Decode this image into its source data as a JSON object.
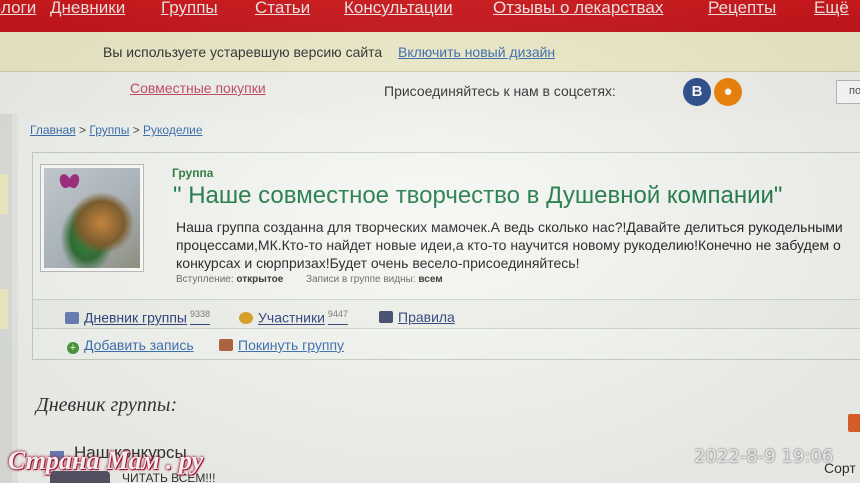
{
  "topnav": {
    "items": [
      "Блоги",
      "Дневники",
      "Группы",
      "Статьи",
      "Консультации",
      "Отзывы о лекарствах",
      "Рецепты",
      "Ещё"
    ]
  },
  "notice": {
    "text": "Вы используете устаревшую версию сайта",
    "link": "Включить новый дизайн"
  },
  "jointbar": {
    "purchases": "Совместные покупки",
    "join_text": "Присоединяйтесь к нам в соцсетях:",
    "vk": "В",
    "ok": "Ok",
    "search_stub": "по"
  },
  "breadcrumb": {
    "home": "Главная",
    "sep1": " > ",
    "groups": "Группы",
    "sep2": " > ",
    "craft": "Рукоделие"
  },
  "group": {
    "type": "Группа",
    "title": "\" Наше совместное творчество в Душевной компании\"",
    "description": "Наша группа созданна для творческих мамочек.А ведь сколько нас?!Давайте делиться рукодельными процессами,МК.Кто-то найдет новые идеи,а кто-то научится новому рукоделию!Конечно не забудем о конкурсах и сюрпризах!Будет очень весело-присоединяйтесь!",
    "join_label": "Вступление:",
    "join_value": "открытое",
    "visible_label": "Записи в группе видны:",
    "visible_value": "всем"
  },
  "tabs": {
    "diary": "Дневник группы",
    "diary_count": "9338",
    "members": "Участники",
    "members_count": "9447",
    "rules": "Правила"
  },
  "actions": {
    "add": "Добавить запись",
    "leave": "Покинуть группу"
  },
  "diary": {
    "heading": "Дневник группы:",
    "post_title": "Наш конкурсы",
    "read_all": "ЧИТАТЬ ВСЕМ!!!",
    "sort": "Сорт"
  },
  "watermark": {
    "site": "Страна Мам . ру",
    "datetime": "2022-8-9  19:06"
  },
  "colors": {
    "nav_red": "#c5161b",
    "group_green": "#1f7a47",
    "link_blue": "#3b6fb0",
    "vk_blue": "#2d4f8e",
    "ok_orange": "#ee8208"
  }
}
